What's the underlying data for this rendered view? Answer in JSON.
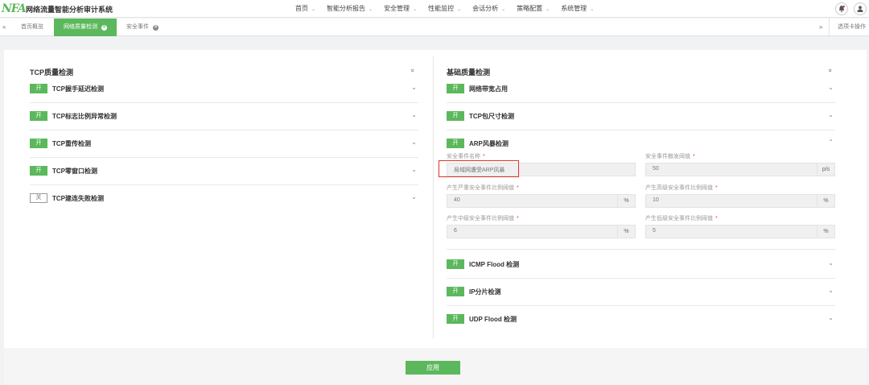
{
  "header": {
    "logo_text": "NFA",
    "title": "网络流量智能分析审计系统",
    "nav": [
      {
        "label": "首页"
      },
      {
        "label": "智能分析报告"
      },
      {
        "label": "安全管理"
      },
      {
        "label": "性能监控"
      },
      {
        "label": "会话分析"
      },
      {
        "label": "策略配置"
      },
      {
        "label": "系统管理"
      }
    ],
    "icons": [
      "bell-icon",
      "user-icon"
    ]
  },
  "tabs": {
    "items": [
      {
        "label": "首页概览",
        "active": false
      },
      {
        "label": "网络质量检测",
        "active": true
      },
      {
        "label": "安全事件",
        "active": false
      }
    ],
    "ops_label": "选项卡操作"
  },
  "left": {
    "title": "TCP质量检测",
    "rows": [
      {
        "label": "TCP握手延迟检测",
        "toggle": "开"
      },
      {
        "label": "TCP标志比例异常检测",
        "toggle": "开"
      },
      {
        "label": "TCP重传检测",
        "toggle": "开"
      },
      {
        "label": "TCP零窗口检测",
        "toggle": "开"
      },
      {
        "label": "TCP建连失败检测",
        "toggle": "关"
      }
    ]
  },
  "right": {
    "title": "基础质量检测",
    "rows_top": [
      {
        "label": "网络带宽占用",
        "toggle": "开"
      },
      {
        "label": "TCP包尺寸检测",
        "toggle": "开"
      },
      {
        "label": "ARP风暴检测",
        "toggle": "开"
      }
    ],
    "arp_form": {
      "event_name_label": "安全事件名称",
      "event_name_value": "局域网遭受ARP风暴",
      "trigger_label": "安全事件触发阈值",
      "trigger_value": "50",
      "trigger_unit": "p/s",
      "severe_label": "产生严重安全事件比例阈值",
      "severe_value": "40",
      "high_label": "产生高级安全事件比例阈值",
      "high_value": "10",
      "medium_label": "产生中级安全事件比例阈值",
      "medium_value": "6",
      "low_label": "产生低级安全事件比例阈值",
      "low_value": "5",
      "percent_unit": "%",
      "required_mark": "*"
    },
    "rows_bottom": [
      {
        "label": "ICMP Flood 检测",
        "toggle": "开"
      },
      {
        "label": "IP分片检测",
        "toggle": "开"
      },
      {
        "label": "UDP Flood 检测",
        "toggle": "开"
      }
    ]
  },
  "footer": {
    "apply_label": "应用"
  },
  "glyphs": {
    "caret": "⌄",
    "chevron_down": "⌄",
    "chevron_up": "⌃",
    "collapse_all": "»",
    "tab_prev": "«",
    "tab_next": "»",
    "close": "×"
  },
  "colors": {
    "accent": "#5cb85c",
    "link": "#4a90c8",
    "highlight_border": "#d9342b"
  }
}
